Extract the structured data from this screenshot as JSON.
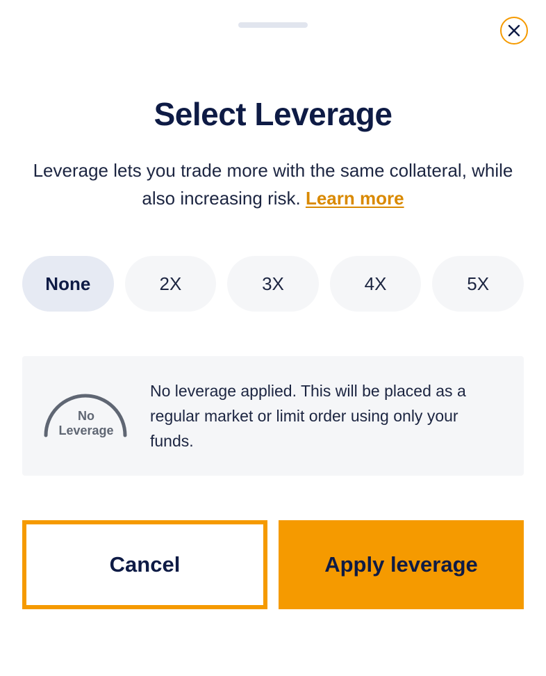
{
  "modal": {
    "title": "Select Leverage",
    "description": "Leverage lets you trade more with the same collateral, while also increasing risk.",
    "learn_more": "Learn more",
    "close_icon": "close-icon"
  },
  "leverage": {
    "options": [
      {
        "label": "None",
        "selected": true
      },
      {
        "label": "2X",
        "selected": false
      },
      {
        "label": "3X",
        "selected": false
      },
      {
        "label": "4X",
        "selected": false
      },
      {
        "label": "5X",
        "selected": false
      }
    ]
  },
  "info": {
    "gauge_line1": "No",
    "gauge_line2": "Leverage",
    "text": "No leverage applied. This will be placed as a regular market or limit order using only your funds."
  },
  "actions": {
    "cancel_label": "Cancel",
    "apply_label": "Apply leverage"
  },
  "colors": {
    "accent": "#f59a00",
    "title": "#0e1b45",
    "option_bg": "#f5f6f8",
    "option_selected_bg": "#e6eaf3",
    "gauge": "#5f6673"
  }
}
